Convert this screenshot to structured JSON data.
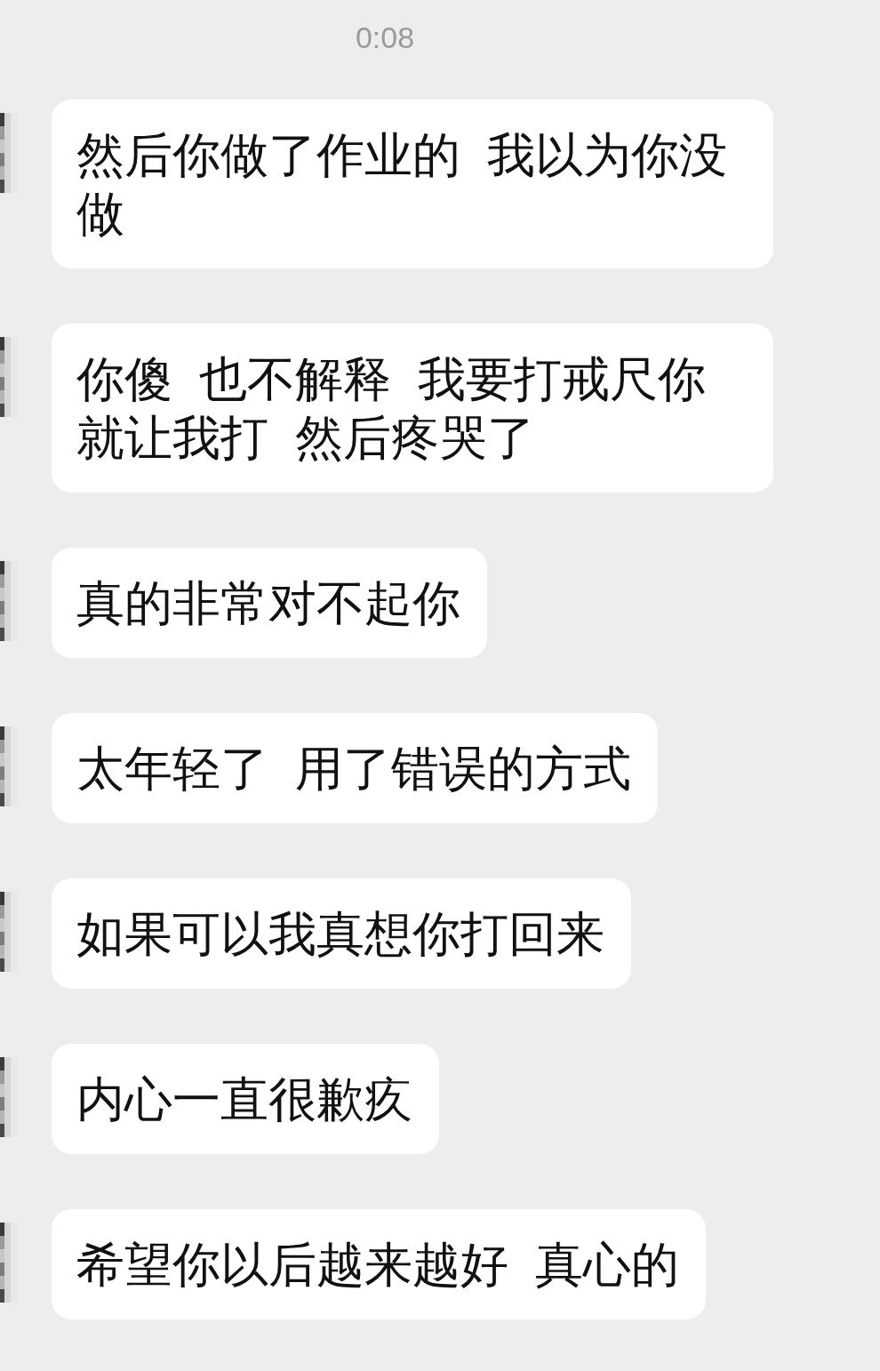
{
  "time": "0:08",
  "messages": [
    {
      "text": "然后你做了作业的  我以为你没做"
    },
    {
      "text": "你傻  也不解释  我要打戒尺你就让我打  然后疼哭了"
    },
    {
      "text": "真的非常对不起你"
    },
    {
      "text": "太年轻了  用了错误的方式"
    },
    {
      "text": "如果可以我真想你打回来"
    },
    {
      "text": "内心一直很歉疚"
    },
    {
      "text": "希望你以后越来越好  真心的"
    }
  ]
}
